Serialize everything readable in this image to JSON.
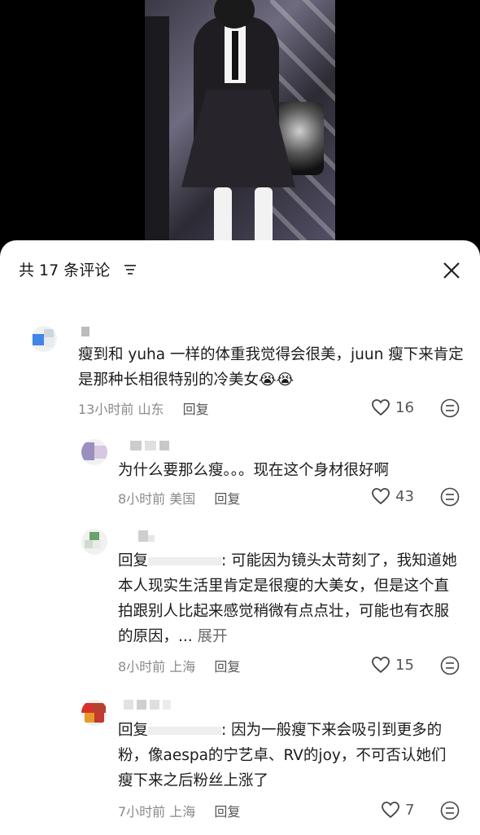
{
  "header": {
    "title": "共 17 条评论",
    "filter_icon": "filter-icon",
    "close_icon": "close-icon"
  },
  "comments": [
    {
      "text": "瘦到和 yuha 一样的体重我觉得会很美，juun 瘦下来肯定是那种长相很特别的冷美女",
      "emoji": "😭😭",
      "time": "13小时前",
      "location": "山东",
      "reply_label": "回复",
      "likes": "16"
    },
    {
      "text": "为什么要那么瘦。。。现在这个身材很好啊",
      "time": "8小时前",
      "location": "美国",
      "reply_label": "回复",
      "likes": "43"
    },
    {
      "reply_prefix": "回复",
      "text": ": 可能因为镜头太苛刻了，我知道她本人现实生活里肯定是很瘦的大美女，但是这个直拍跟别人比起来感觉稍微有点点壮，可能也有衣服的原因，...",
      "expand_label": "展开",
      "time": "8小时前",
      "location": "上海",
      "reply_label": "回复",
      "likes": "15"
    },
    {
      "reply_prefix": "回复",
      "text": ": 因为一般瘦下来会吸引到更多的粉，像aespa的宁艺卓、RV的joy，不可否认她们瘦下来之后粉丝上涨了",
      "time": "7小时前",
      "location": "上海",
      "reply_label": "回复",
      "likes": "7"
    }
  ],
  "colors": {
    "sheet_bg": "#ffffff",
    "text": "#1b1b1b",
    "meta": "#8a8a8a"
  }
}
